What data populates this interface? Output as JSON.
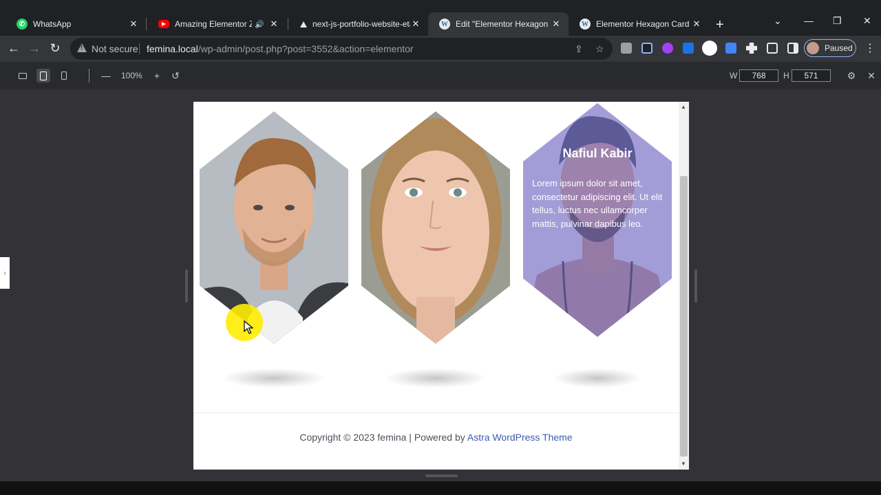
{
  "browser": {
    "tabs": [
      {
        "title": "WhatsApp",
        "icon": "whatsapp-icon",
        "active": false
      },
      {
        "title": "Amazing Elementor ZOO",
        "icon": "youtube-icon",
        "active": false,
        "audio": true
      },
      {
        "title": "next-js-portfolio-website-eta",
        "icon": "vercel-icon",
        "active": false
      },
      {
        "title": "Edit \"Elementor Hexagon Ca",
        "icon": "wordpress-icon",
        "active": true
      },
      {
        "title": "Elementor Hexagon Card – fe",
        "icon": "wordpress-icon",
        "active": false
      }
    ],
    "security_label": "Not secure",
    "url_host": "femina.local",
    "url_path": "/wp-admin/post.php?post=3552&action=elementor",
    "profile_label": "Paused"
  },
  "responsive_bar": {
    "zoom": "100%",
    "width_label": "W",
    "width_value": "768",
    "height_label": "H",
    "height_value": "571"
  },
  "preview": {
    "cards": [
      {
        "image": "portrait-man-blond"
      },
      {
        "image": "portrait-woman"
      },
      {
        "image": "portrait-man-dark",
        "name": "Nafiul Kabir",
        "description": "Lorem ipsum dolor sit amet, consectetur adipiscing elit. Ut elit tellus, luctus nec ullamcorper mattis, pulvinar dapibus leo."
      }
    ],
    "footer": {
      "text": "Copyright © 2023 femina | Powered by ",
      "link": "Astra WordPress Theme"
    }
  },
  "colors": {
    "chrome_bg": "#202124",
    "toolbar_bg": "#35363a",
    "stage_bg": "#333337",
    "card_overlay": "#786ed2",
    "footer_link": "#3a5bb0"
  }
}
